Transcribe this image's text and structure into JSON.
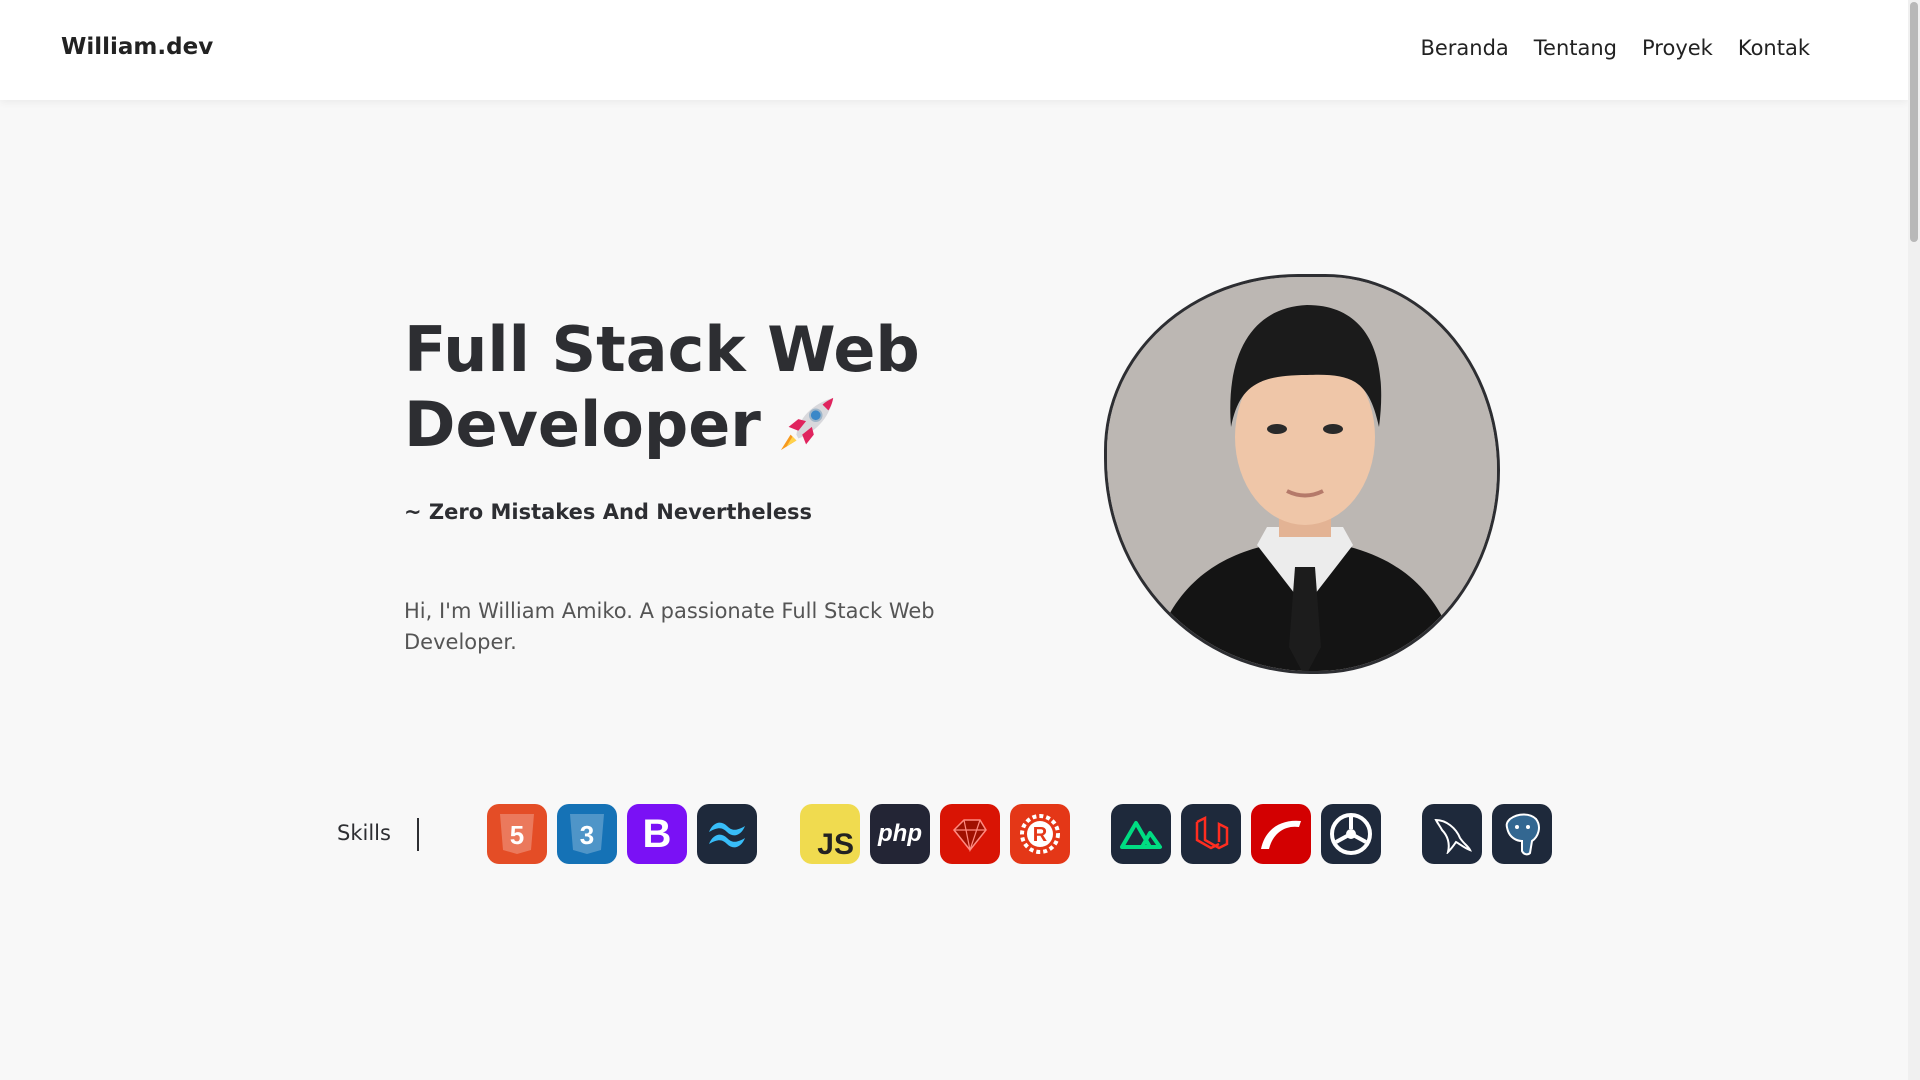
{
  "nav": {
    "logo": "William.dev",
    "links": [
      "Beranda",
      "Tentang",
      "Proyek",
      "Kontak"
    ]
  },
  "hero": {
    "title_line1": "Full Stack Web",
    "title_line2": "Developer",
    "title_emoji_icon": "rocket-icon",
    "tagline": "~ Zero Mistakes And Nevertheless",
    "intro": "Hi, I'm William Amiko. A passionate Full Stack Web Developer."
  },
  "skills": {
    "label": "Skills",
    "groups": [
      [
        {
          "name": "html5-icon",
          "bg": "#e44d26",
          "text": "5"
        },
        {
          "name": "css3-icon",
          "bg": "#1572b6",
          "text": "3"
        },
        {
          "name": "bootstrap-icon",
          "bg": "#7a11f5",
          "text": "B"
        },
        {
          "name": "tailwind-icon",
          "bg": "#1e293b",
          "text": ""
        }
      ],
      [
        {
          "name": "javascript-icon",
          "bg": "#f0db4f",
          "text": "JS"
        },
        {
          "name": "php-icon",
          "bg": "#232535",
          "text": "php"
        },
        {
          "name": "ruby-icon",
          "bg": "#d91404",
          "text": ""
        },
        {
          "name": "rust-icon",
          "bg": "#e43717",
          "text": "R"
        }
      ],
      [
        {
          "name": "nuxt-icon",
          "bg": "#1e293b",
          "text": ""
        },
        {
          "name": "laravel-icon",
          "bg": "#1e293b",
          "text": ""
        },
        {
          "name": "rails-icon",
          "bg": "#d30001",
          "text": ""
        },
        {
          "name": "actix-icon",
          "bg": "#1e293b",
          "text": ""
        }
      ],
      [
        {
          "name": "mysql-icon",
          "bg": "#1e293b",
          "text": ""
        },
        {
          "name": "postgresql-icon",
          "bg": "#1e293b",
          "text": ""
        }
      ]
    ]
  },
  "colors": {
    "background": "#f8f8f8",
    "navbar": "#ffffff",
    "text": "#2d2e32",
    "muted_text": "#555555"
  }
}
